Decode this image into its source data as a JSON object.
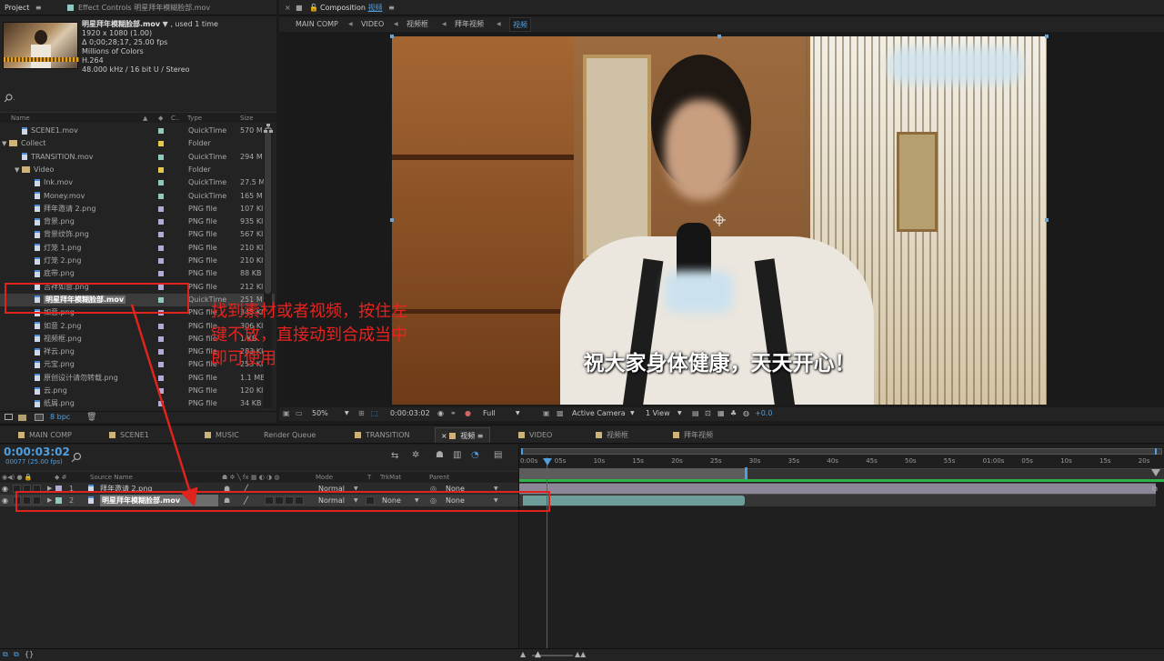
{
  "project_panel": {
    "tab_project": "Project",
    "tab_menu_icon": "≡",
    "tab_effect_controls": "Effect Controls 明星拜年模糊脸部.mov",
    "asset_name": "明星拜年模糊脸部.mov",
    "asset_used": "▼ , used 1 time",
    "asset_info": [
      "1920 x 1080 (1.00)",
      "Δ 0;00;28;17, 25.00 fps",
      "Millions of Colors",
      "H.264",
      "48.000 kHz / 16 bit U / Stereo"
    ],
    "search_icon": "search-icon",
    "columns": {
      "name": "Name",
      "label": "C..",
      "type": "Type",
      "size": "Size"
    },
    "items": [
      {
        "name": "SCENE1.mov",
        "kind": "file",
        "indent": 1,
        "label_color": "#8fc9c0",
        "type": "QuickTime",
        "size": "570 M"
      },
      {
        "name": "Collect",
        "kind": "folder",
        "indent": 0,
        "open": true,
        "label_color": "#e6c84b",
        "type": "Folder",
        "size": ""
      },
      {
        "name": "TRANSITION.mov",
        "kind": "file",
        "indent": 1,
        "label_color": "#8fc9c0",
        "type": "QuickTime",
        "size": "294 M"
      },
      {
        "name": "Video",
        "kind": "folder",
        "indent": 1,
        "open": true,
        "label_color": "#e6c84b",
        "type": "Folder",
        "size": ""
      },
      {
        "name": "Ink.mov",
        "kind": "file",
        "indent": 2,
        "label_color": "#8fc9c0",
        "type": "QuickTime",
        "size": "27.5 M"
      },
      {
        "name": "Money.mov",
        "kind": "file",
        "indent": 2,
        "label_color": "#8fc9c0",
        "type": "QuickTime",
        "size": "165 M"
      },
      {
        "name": "拜年邀请 2.png",
        "kind": "file",
        "indent": 2,
        "label_color": "#b7a9d6",
        "type": "PNG file",
        "size": "107 KI"
      },
      {
        "name": "背景.png",
        "kind": "file",
        "indent": 2,
        "label_color": "#b7a9d6",
        "type": "PNG file",
        "size": "935 KI"
      },
      {
        "name": "背景纹饰.png",
        "kind": "file",
        "indent": 2,
        "label_color": "#b7a9d6",
        "type": "PNG file",
        "size": "567 KI"
      },
      {
        "name": "灯笼 1.png",
        "kind": "file",
        "indent": 2,
        "label_color": "#b7a9d6",
        "type": "PNG file",
        "size": "210 KI"
      },
      {
        "name": "灯笼 2.png",
        "kind": "file",
        "indent": 2,
        "label_color": "#b7a9d6",
        "type": "PNG file",
        "size": "210 KI"
      },
      {
        "name": "底带.png",
        "kind": "file",
        "indent": 2,
        "label_color": "#b7a9d6",
        "type": "PNG file",
        "size": "88 KB"
      },
      {
        "name": "吉祥如意.png",
        "kind": "file",
        "indent": 2,
        "label_color": "#b7a9d6",
        "type": "PNG file",
        "size": "212 KI"
      },
      {
        "name": "明星拜年模糊脸部.mov",
        "kind": "file",
        "indent": 2,
        "selected": true,
        "label_color": "#8fc9c0",
        "type": "QuickTime",
        "size": "251 M"
      },
      {
        "name": "如意.png",
        "kind": "file",
        "indent": 2,
        "label_color": "#b7a9d6",
        "type": "PNG file",
        "size": "345 KI"
      },
      {
        "name": "如意 2.png",
        "kind": "file",
        "indent": 2,
        "label_color": "#b7a9d6",
        "type": "PNG file",
        "size": "306 KI"
      },
      {
        "name": "视频框.png",
        "kind": "file",
        "indent": 2,
        "label_color": "#b7a9d6",
        "type": "PNG file",
        "size": "1 KB"
      },
      {
        "name": "祥云.png",
        "kind": "file",
        "indent": 2,
        "label_color": "#b7a9d6",
        "type": "PNG file",
        "size": "283 KI"
      },
      {
        "name": "元宝.png",
        "kind": "file",
        "indent": 2,
        "label_color": "#b7a9d6",
        "type": "PNG file",
        "size": "253 KI"
      },
      {
        "name": "原创设计请勿转载.png",
        "kind": "file",
        "indent": 2,
        "label_color": "#b7a9d6",
        "type": "PNG file",
        "size": "1.1 MB"
      },
      {
        "name": "云.png",
        "kind": "file",
        "indent": 2,
        "label_color": "#b7a9d6",
        "type": "PNG file",
        "size": "120 KI"
      },
      {
        "name": "纸屑.png",
        "kind": "file",
        "indent": 2,
        "label_color": "#b7a9d6",
        "type": "PNG file",
        "size": "34 KB"
      }
    ],
    "footer_bpc": "8 bpc"
  },
  "composition_panel": {
    "tab_label": "Composition",
    "tab_comp": "视频",
    "breadcrumbs": [
      "MAIN COMP",
      "VIDEO",
      "视频框",
      "拜年视频",
      "视频"
    ],
    "subtitle": "祝大家身体健康，天天开心！",
    "zoom": "50%",
    "timecode": "0:00:03:02",
    "resolution": "Full",
    "camera": "Active Camera",
    "views": "1 View",
    "exposure": "+0.0"
  },
  "annotation": {
    "text": "找到素材或者视频，按住左键不放，直接动到合成当中即可使用"
  },
  "timeline": {
    "tabs": [
      "MAIN COMP",
      "SCENE1",
      "MUSIC",
      "Render Queue",
      "TRANSITION",
      "视频",
      "VIDEO",
      "视频框",
      "拜年视频"
    ],
    "timecode": "0:00:03:02",
    "frame_info": "00077 (25.00 fps)",
    "col_source": "Source Name",
    "col_mode": "Mode",
    "col_t": "T",
    "col_trkmat": "TrkMat",
    "col_parent": "Parent",
    "ruler": [
      "0:00s",
      "05s",
      "10s",
      "15s",
      "20s",
      "25s",
      "30s",
      "35s",
      "40s",
      "45s",
      "50s",
      "55s",
      "01:00s",
      "05s",
      "10s",
      "15s",
      "20s"
    ],
    "layers": [
      {
        "num": "1",
        "name": "拜年邀请 2.png",
        "mode": "Normal",
        "trkmat": "",
        "parent": "None",
        "color": "#b7a9d6"
      },
      {
        "num": "2",
        "name": "明星拜年模糊脸部.mov",
        "mode": "Normal",
        "trkmat": "None",
        "parent": "None",
        "color": "#8fc9c0"
      }
    ]
  }
}
